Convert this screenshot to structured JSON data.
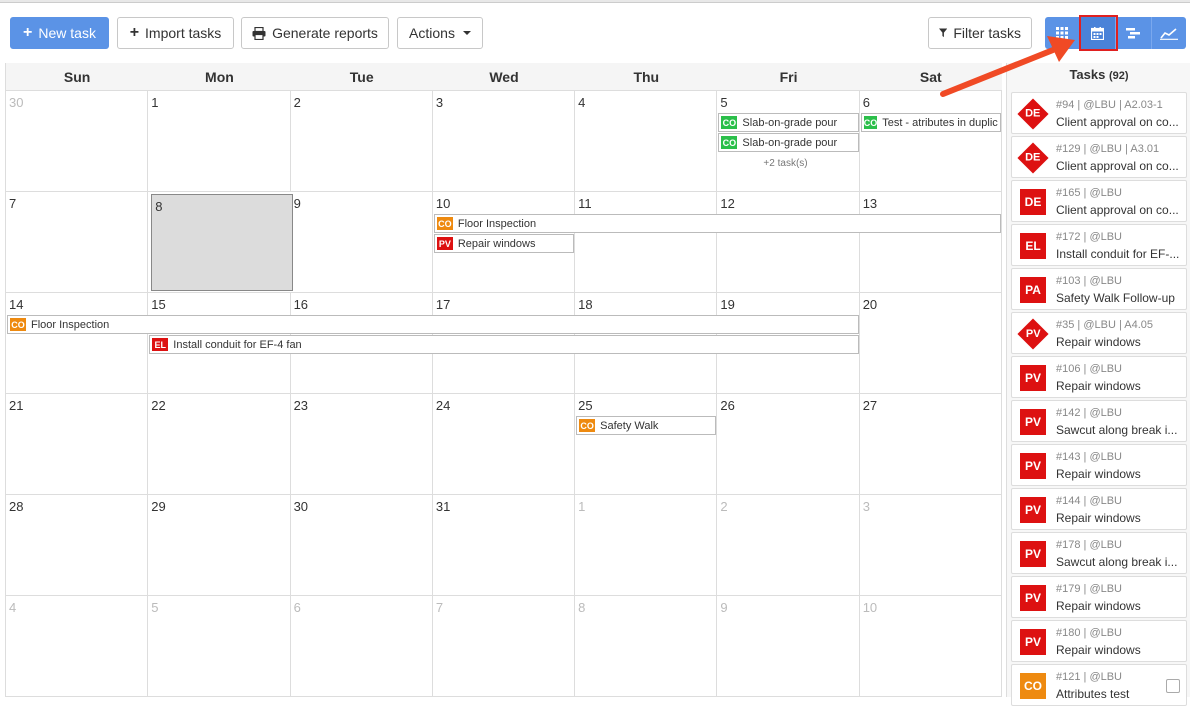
{
  "toolbar": {
    "new_task": "New task",
    "import_tasks": "Import tasks",
    "generate_reports": "Generate reports",
    "actions": "Actions",
    "filter_tasks": "Filter tasks",
    "views": [
      "grid-view",
      "calendar-view",
      "gantt-view",
      "chart-view"
    ],
    "active_view": "calendar-view"
  },
  "calendar": {
    "day_names": [
      "Sun",
      "Mon",
      "Tue",
      "Wed",
      "Thu",
      "Fri",
      "Sat"
    ],
    "weeks": [
      [
        {
          "d": "30",
          "other": true
        },
        {
          "d": "1"
        },
        {
          "d": "2"
        },
        {
          "d": "3"
        },
        {
          "d": "4"
        },
        {
          "d": "5"
        },
        {
          "d": "6"
        }
      ],
      [
        {
          "d": "7"
        },
        {
          "d": "8",
          "today": true
        },
        {
          "d": "9"
        },
        {
          "d": "10"
        },
        {
          "d": "11"
        },
        {
          "d": "12"
        },
        {
          "d": "13"
        }
      ],
      [
        {
          "d": "14"
        },
        {
          "d": "15"
        },
        {
          "d": "16"
        },
        {
          "d": "17"
        },
        {
          "d": "18"
        },
        {
          "d": "19"
        },
        {
          "d": "20"
        }
      ],
      [
        {
          "d": "21"
        },
        {
          "d": "22"
        },
        {
          "d": "23"
        },
        {
          "d": "24"
        },
        {
          "d": "25"
        },
        {
          "d": "26"
        },
        {
          "d": "27"
        }
      ],
      [
        {
          "d": "28"
        },
        {
          "d": "29"
        },
        {
          "d": "30"
        },
        {
          "d": "31"
        },
        {
          "d": "1",
          "other": true
        },
        {
          "d": "2",
          "other": true
        },
        {
          "d": "3",
          "other": true
        }
      ],
      [
        {
          "d": "4",
          "other": true
        },
        {
          "d": "5",
          "other": true
        },
        {
          "d": "6",
          "other": true
        },
        {
          "d": "7",
          "other": true
        },
        {
          "d": "8",
          "other": true
        },
        {
          "d": "9",
          "other": true
        },
        {
          "d": "10",
          "other": true
        }
      ]
    ],
    "events": [
      {
        "week": 0,
        "start": 5,
        "span": 1,
        "row": 0,
        "badge": "CO",
        "color": "co-green",
        "label": "Slab-on-grade pour"
      },
      {
        "week": 0,
        "start": 5,
        "span": 1,
        "row": 1,
        "badge": "CO",
        "color": "co-green",
        "label": "Slab-on-grade pour"
      },
      {
        "week": 0,
        "start": 6,
        "span": 1,
        "row": 0,
        "badge": "CO",
        "color": "co-green",
        "label": "Test - atributes in duplic"
      },
      {
        "week": 1,
        "start": 3,
        "span": 4,
        "row": 0,
        "badge": "CO",
        "color": "co-orange",
        "label": "Floor Inspection"
      },
      {
        "week": 1,
        "start": 3,
        "span": 1,
        "row": 1,
        "badge": "PV",
        "color": "pv",
        "label": "Repair windows"
      },
      {
        "week": 2,
        "start": 0,
        "span": 6,
        "row": 0,
        "badge": "CO",
        "color": "co-orange",
        "label": "Floor Inspection"
      },
      {
        "week": 2,
        "start": 1,
        "span": 5,
        "row": 1,
        "badge": "EL",
        "color": "el",
        "label": "Install conduit for EF-4 fan"
      },
      {
        "week": 3,
        "start": 4,
        "span": 1,
        "row": 0,
        "badge": "CO",
        "color": "co-orange",
        "label": "Safety Walk"
      }
    ],
    "more": [
      {
        "week": 0,
        "day": 5,
        "text": "+2 task(s)"
      }
    ]
  },
  "sidebar": {
    "title": "Tasks",
    "count": "(92)",
    "tasks": [
      {
        "badge": "DE",
        "shape": "diamond",
        "color": "red",
        "meta": "#94 | @LBU | A2.03-1",
        "name": "Client approval on co..."
      },
      {
        "badge": "DE",
        "shape": "diamond",
        "color": "red",
        "meta": "#129 | @LBU | A3.01",
        "name": "Client approval on co..."
      },
      {
        "badge": "DE",
        "shape": "square",
        "color": "red",
        "meta": "#165 | @LBU",
        "name": "Client approval on co..."
      },
      {
        "badge": "EL",
        "shape": "square",
        "color": "red",
        "meta": "#172 | @LBU",
        "name": "Install conduit for EF-..."
      },
      {
        "badge": "PA",
        "shape": "square",
        "color": "red",
        "meta": "#103 | @LBU",
        "name": "Safety Walk Follow-up"
      },
      {
        "badge": "PV",
        "shape": "diamond",
        "color": "red",
        "meta": "#35 | @LBU | A4.05",
        "name": "Repair windows"
      },
      {
        "badge": "PV",
        "shape": "square",
        "color": "red",
        "meta": "#106 | @LBU",
        "name": "Repair windows"
      },
      {
        "badge": "PV",
        "shape": "square",
        "color": "red",
        "meta": "#142 | @LBU",
        "name": "Sawcut along break i..."
      },
      {
        "badge": "PV",
        "shape": "square",
        "color": "red",
        "meta": "#143 | @LBU",
        "name": "Repair windows"
      },
      {
        "badge": "PV",
        "shape": "square",
        "color": "red",
        "meta": "#144 | @LBU",
        "name": "Repair windows"
      },
      {
        "badge": "PV",
        "shape": "square",
        "color": "red",
        "meta": "#178 | @LBU",
        "name": "Sawcut along break i..."
      },
      {
        "badge": "PV",
        "shape": "square",
        "color": "red",
        "meta": "#179 | @LBU",
        "name": "Repair windows"
      },
      {
        "badge": "PV",
        "shape": "square",
        "color": "red",
        "meta": "#180 | @LBU",
        "name": "Repair windows"
      },
      {
        "badge": "CO",
        "shape": "square",
        "color": "orange",
        "meta": "#121 | @LBU",
        "name": "Attributes test",
        "checkbox": true
      }
    ]
  },
  "colors": {
    "primary": "#5b93e6",
    "danger": "#dd1111",
    "success": "#2bbf4a",
    "warning": "#ee8a10",
    "highlight": "#e02020"
  }
}
